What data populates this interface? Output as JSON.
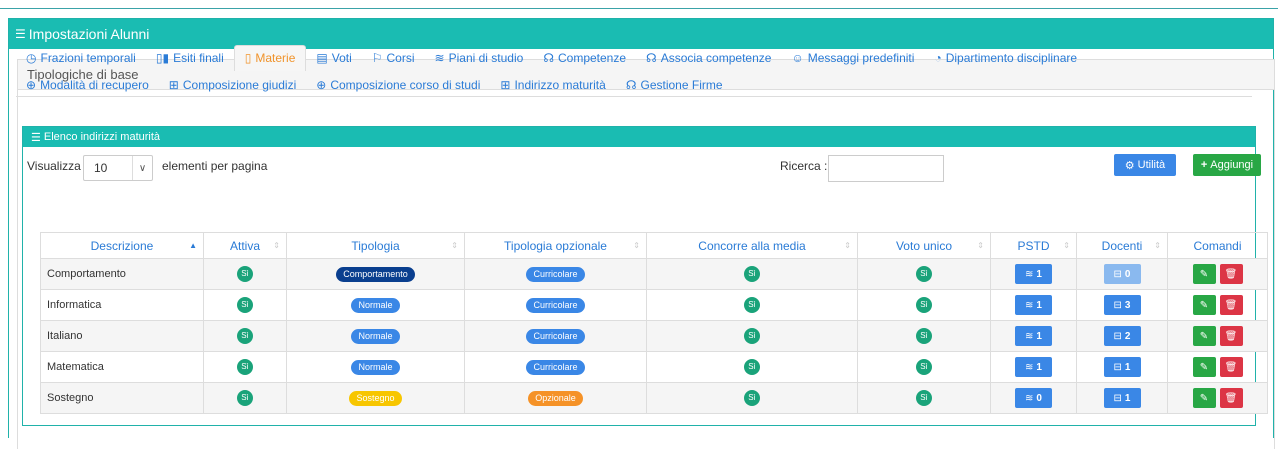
{
  "page": {
    "title": "Impostazioni Alunni"
  },
  "base_panel": {
    "title": "Tipologiche di base"
  },
  "tabs": [
    {
      "label": "Frazioni temporali",
      "icon": "◷",
      "active": false
    },
    {
      "label": "Esiti finali",
      "icon": "▯▮",
      "active": false
    },
    {
      "label": "Materie",
      "icon": "▯",
      "active": true
    },
    {
      "label": "Voti",
      "icon": "▤",
      "active": false
    },
    {
      "label": "Corsi",
      "icon": "⚐",
      "active": false
    },
    {
      "label": "Piani di studio",
      "icon": "≋",
      "active": false
    },
    {
      "label": "Competenze",
      "icon": "☊",
      "active": false
    },
    {
      "label": "Associa competenze",
      "icon": "☊",
      "active": false
    },
    {
      "label": "Messaggi predefiniti",
      "icon": "☺",
      "active": false
    },
    {
      "label": "Dipartimento disciplinare",
      "icon": "◔",
      "active": false
    },
    {
      "label": "Modalità di recupero",
      "icon": "⊕",
      "active": false
    },
    {
      "label": "Composizione giudizi",
      "icon": "⊞",
      "active": false
    },
    {
      "label": "Composizione corso di studi",
      "icon": "⊕",
      "active": false
    },
    {
      "label": "Indirizzo maturità",
      "icon": "⊞",
      "active": false
    },
    {
      "label": "Gestione Firme",
      "icon": "☊",
      "active": false
    }
  ],
  "list": {
    "title": "Elenco indirizzi maturità",
    "show_label": "Visualizza",
    "page_size": "10",
    "per_page_label": "elementi per pagina",
    "search_label": "Ricerca :",
    "search_value": "",
    "utility_label": "Utilità",
    "add_label": "Aggiungi"
  },
  "table": {
    "headers": [
      "Descrizione",
      "Attiva",
      "Tipologia",
      "Tipologia opzionale",
      "Concorre alla media",
      "Voto unico",
      "PSTD",
      "Docenti",
      "Comandi"
    ],
    "rows": [
      {
        "descrizione": "Comportamento",
        "attiva": "Sì",
        "tipologia": "Comportamento",
        "tipologia_color": "dark",
        "opzionale": "Curricolare",
        "opzionale_color": "blue",
        "media": "Sì",
        "voto": "Sì",
        "pstd": "1",
        "docenti": "0",
        "docenti_light": true
      },
      {
        "descrizione": "Informatica",
        "attiva": "Sì",
        "tipologia": "Normale",
        "tipologia_color": "blue",
        "opzionale": "Curricolare",
        "opzionale_color": "blue",
        "media": "Sì",
        "voto": "Sì",
        "pstd": "1",
        "docenti": "3",
        "docenti_light": false
      },
      {
        "descrizione": "Italiano",
        "attiva": "Sì",
        "tipologia": "Normale",
        "tipologia_color": "blue",
        "opzionale": "Curricolare",
        "opzionale_color": "blue",
        "media": "Sì",
        "voto": "Sì",
        "pstd": "1",
        "docenti": "2",
        "docenti_light": false
      },
      {
        "descrizione": "Matematica",
        "attiva": "Sì",
        "tipologia": "Normale",
        "tipologia_color": "blue",
        "opzionale": "Curricolare",
        "opzionale_color": "blue",
        "media": "Sì",
        "voto": "Sì",
        "pstd": "1",
        "docenti": "1",
        "docenti_light": false
      },
      {
        "descrizione": "Sostegno",
        "attiva": "Sì",
        "tipologia": "Sostegno",
        "tipologia_color": "yellow",
        "opzionale": "Opzionale",
        "opzionale_color": "orange",
        "media": "Sì",
        "voto": "Sì",
        "pstd": "0",
        "docenti": "1",
        "docenti_light": false
      }
    ]
  },
  "colors": {
    "teal": "#1abcb2",
    "blue": "#3a87e6",
    "green": "#28a745",
    "red": "#dc3545",
    "orange": "#f0932b"
  }
}
